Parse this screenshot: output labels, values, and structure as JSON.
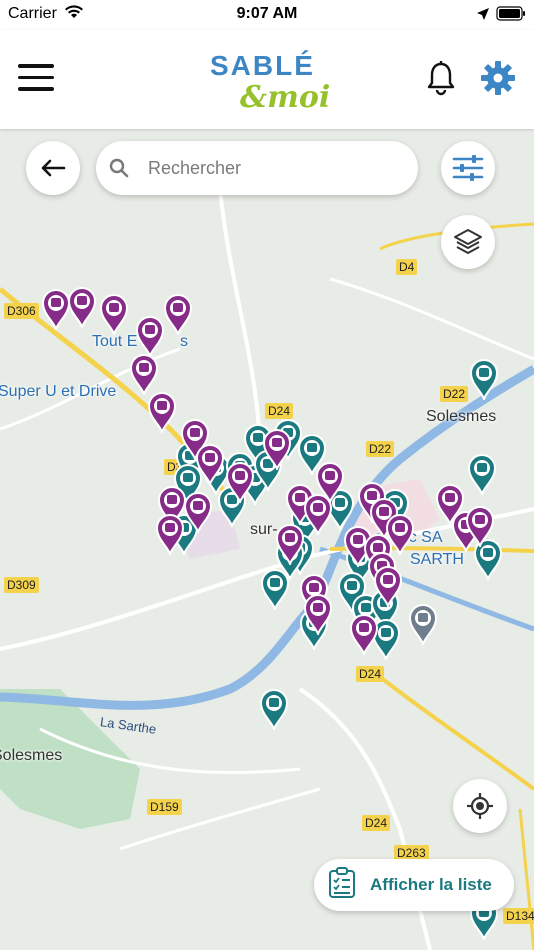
{
  "status_bar": {
    "carrier": "Carrier",
    "time": "9:07 AM"
  },
  "header": {
    "logo_top": "SABLÉ",
    "logo_bottom": "&moi",
    "menu_icon": "hamburger-icon",
    "notification_icon": "bell-icon",
    "settings_icon": "gear-icon"
  },
  "search": {
    "placeholder": "Rechercher"
  },
  "map": {
    "road_labels": [
      "D306",
      "D30",
      "D24",
      "D22",
      "D4",
      "D22",
      "D309",
      "D24",
      "D159",
      "D24",
      "D263",
      "D134"
    ],
    "place_labels": [
      "Super U et Drive",
      "Solesmes",
      "Solesmes",
      "Tout E",
      "s",
      "sur-",
      "E.Leclerc SA",
      "SARTH"
    ],
    "river_label": "La Sarthe"
  },
  "list_button": {
    "label": "Afficher la liste"
  },
  "colors": {
    "purple": "#862b87",
    "teal": "#1b7a80",
    "blue": "#3d86c6",
    "green": "#96c12a",
    "water": "#8fb9e4",
    "road": "#f4d24b"
  }
}
